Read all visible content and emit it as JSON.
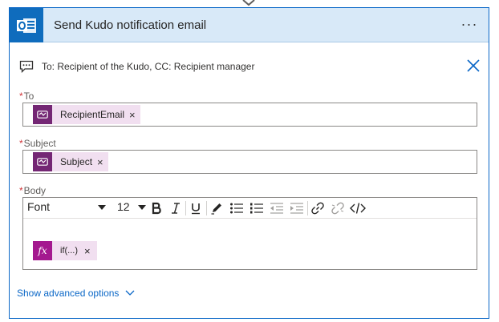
{
  "header": {
    "title": "Send Kudo notification email",
    "more_label": "···"
  },
  "comment": {
    "text": "To: Recipient of the Kudo, CC: Recipient manager"
  },
  "fields": {
    "to": {
      "required_mark": "*",
      "label": "To",
      "token": "RecipientEmail"
    },
    "subject": {
      "required_mark": "*",
      "label": "Subject",
      "token": "Subject"
    },
    "body": {
      "required_mark": "*",
      "label": "Body",
      "font": "Font",
      "size": "12",
      "token": "if(...)",
      "token_icon": "fx"
    }
  },
  "token_remove": "×",
  "advanced": {
    "label": "Show advanced options"
  },
  "colors": {
    "accent": "#0a67c7",
    "header_bg": "#d8e9f8",
    "token_bg": "#f1dff0",
    "token_icon": "#742774",
    "expression_icon": "#a4198f",
    "required": "#d13438"
  },
  "icons": {
    "app": "outlook-icon",
    "comment": "comment-icon",
    "close": "close-icon",
    "toolbar": [
      "bold-icon",
      "italic-icon",
      "underline-icon",
      "pen-icon",
      "bullet-list-icon",
      "numbered-list-icon",
      "outdent-icon",
      "indent-icon",
      "link-icon",
      "unlink-icon",
      "code-view-icon"
    ]
  }
}
